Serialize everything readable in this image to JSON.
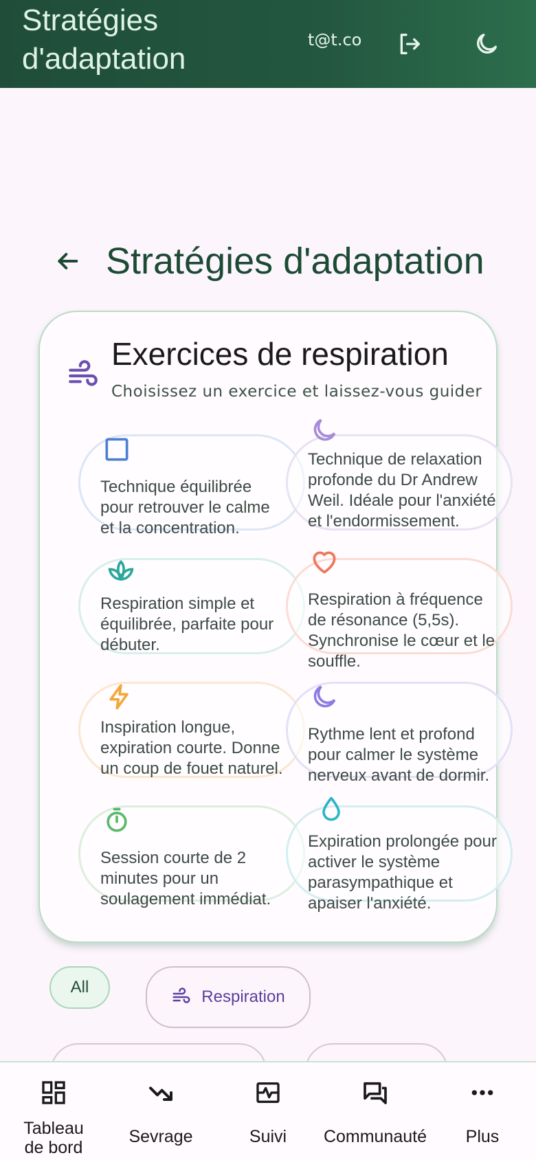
{
  "appbar": {
    "title": "Stratégies d'adaptation",
    "email": "t@t.co",
    "logout_icon": "logout-icon",
    "theme_icon": "moon-icon"
  },
  "page": {
    "title": "Stratégies d'adaptation",
    "back_icon": "arrow-left-icon"
  },
  "breathing_card": {
    "title": "Exercices de respiration",
    "subtitle": "Choisissez un exercice et laissez-vous guider",
    "icon": "wind-icon",
    "exercises": [
      {
        "icon": "square-icon",
        "color": "#4a7fd4",
        "border": "#dbe6f6",
        "description": "Technique équilibrée pour retrouver le calme et la concentration."
      },
      {
        "icon": "moon-icon",
        "color": "#a78bd8",
        "border": "#e8e2f2",
        "description": "Technique de relaxation profonde du Dr Andrew Weil. Idéale pour l'anxiété et l'endormissement."
      },
      {
        "icon": "lotus-icon",
        "color": "#2aa89a",
        "border": "#d8efec",
        "description": "Respiration simple et équilibrée, parfaite pour débuter."
      },
      {
        "icon": "heart-icon",
        "color": "#f0765a",
        "border": "#fbdcd5",
        "description": "Respiration à fréquence de résonance (5,5s). Synchronise le cœur et le souffle."
      },
      {
        "icon": "bolt-icon",
        "color": "#f2a83a",
        "border": "#fae8cf",
        "description": "Inspiration longue, expiration courte. Donne un coup de fouet naturel."
      },
      {
        "icon": "moon-icon",
        "color": "#8f7be0",
        "border": "#e4e0f6",
        "description": "Rythme lent et profond pour calmer le système nerveux avant de dormir."
      },
      {
        "icon": "timer-icon",
        "color": "#5cb86a",
        "border": "#dcefdd",
        "description": "Session courte de 2 minutes pour un soulagement immédiat."
      },
      {
        "icon": "drop-icon",
        "color": "#2bb5c8",
        "border": "#d3eef2",
        "description": "Expiration prolongée pour activer le système parasympathique et apaiser l'anxiété."
      }
    ]
  },
  "filters": {
    "all_label": "All",
    "respiration_label": "Respiration"
  },
  "bottom_nav": [
    {
      "label": "Tableau\nde bord",
      "icon": "dashboard-icon"
    },
    {
      "label": "Sevrage",
      "icon": "trending-down-icon"
    },
    {
      "label": "Suivi",
      "icon": "pulse-icon"
    },
    {
      "label": "Communauté",
      "icon": "forum-icon"
    },
    {
      "label": "Plus",
      "icon": "more-icon"
    }
  ]
}
